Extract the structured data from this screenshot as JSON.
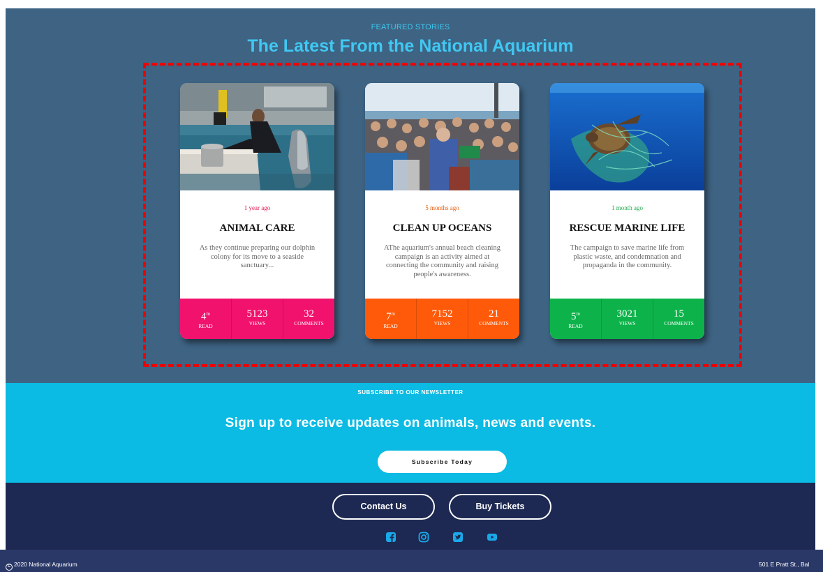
{
  "featured": {
    "eyebrow": "FEATURED STORIES",
    "title": "The Latest From the National Aquarium",
    "title_color": "#40c8f2",
    "background": "#3e6383",
    "cards": [
      {
        "image": "dolphin-trainer-photo",
        "time": "1 year ago",
        "time_color": "#e6154d",
        "title": "ANIMAL CARE",
        "description": "As they continue preparing our dolphin colony for its move to a seaside sanctuary...",
        "accent": "#f0126d",
        "stats": {
          "read_value": "4",
          "read_unit": "m",
          "read_label": "READ",
          "views_value": "5123",
          "views_label": "VIEWS",
          "comments_value": "32",
          "comments_label": "COMMENTS"
        }
      },
      {
        "image": "beach-cleanup-crowd-photo",
        "time": "5 months ago",
        "time_color": "#e65a0a",
        "title": "CLEAN UP OCEANS",
        "description": "AThe aquarium's annual beach cleaning campaign is an activity aimed at connecting the community and raising people's awareness.",
        "accent": "#ff5a0a",
        "stats": {
          "read_value": "7",
          "read_unit": "m",
          "read_label": "READ",
          "views_value": "7152",
          "views_label": "VIEWS",
          "comments_value": "21",
          "comments_label": "COMMENTS"
        }
      },
      {
        "image": "sea-turtle-net-photo",
        "time": "1 month ago",
        "time_color": "#22a84a",
        "title": "RESCUE MARINE LIFE",
        "description": "The campaign to save marine life from plastic waste, and condemnation and propaganda in the community.",
        "accent": "#0db34a",
        "stats": {
          "read_value": "5",
          "read_unit": "m",
          "read_label": "READ",
          "views_value": "3021",
          "views_label": "VIEWS",
          "comments_value": "15",
          "comments_label": "COMMENTS"
        }
      }
    ]
  },
  "newsletter": {
    "eyebrow": "SUBSCRIBE TO OUR NEWSLETTER",
    "title": "Sign up to receive updates on animals, news and events.",
    "button_label": "Subscribe Today",
    "background": "#0bbbe4"
  },
  "footer": {
    "contact_label": "Contact Us",
    "tickets_label": "Buy Tickets",
    "social_icons": [
      "facebook-icon",
      "instagram-icon",
      "twitter-icon",
      "youtube-icon"
    ],
    "social_color": "#1aa9e8",
    "copyright": "2020 National Aquarium",
    "address": "501 E Pratt St., Bal"
  }
}
